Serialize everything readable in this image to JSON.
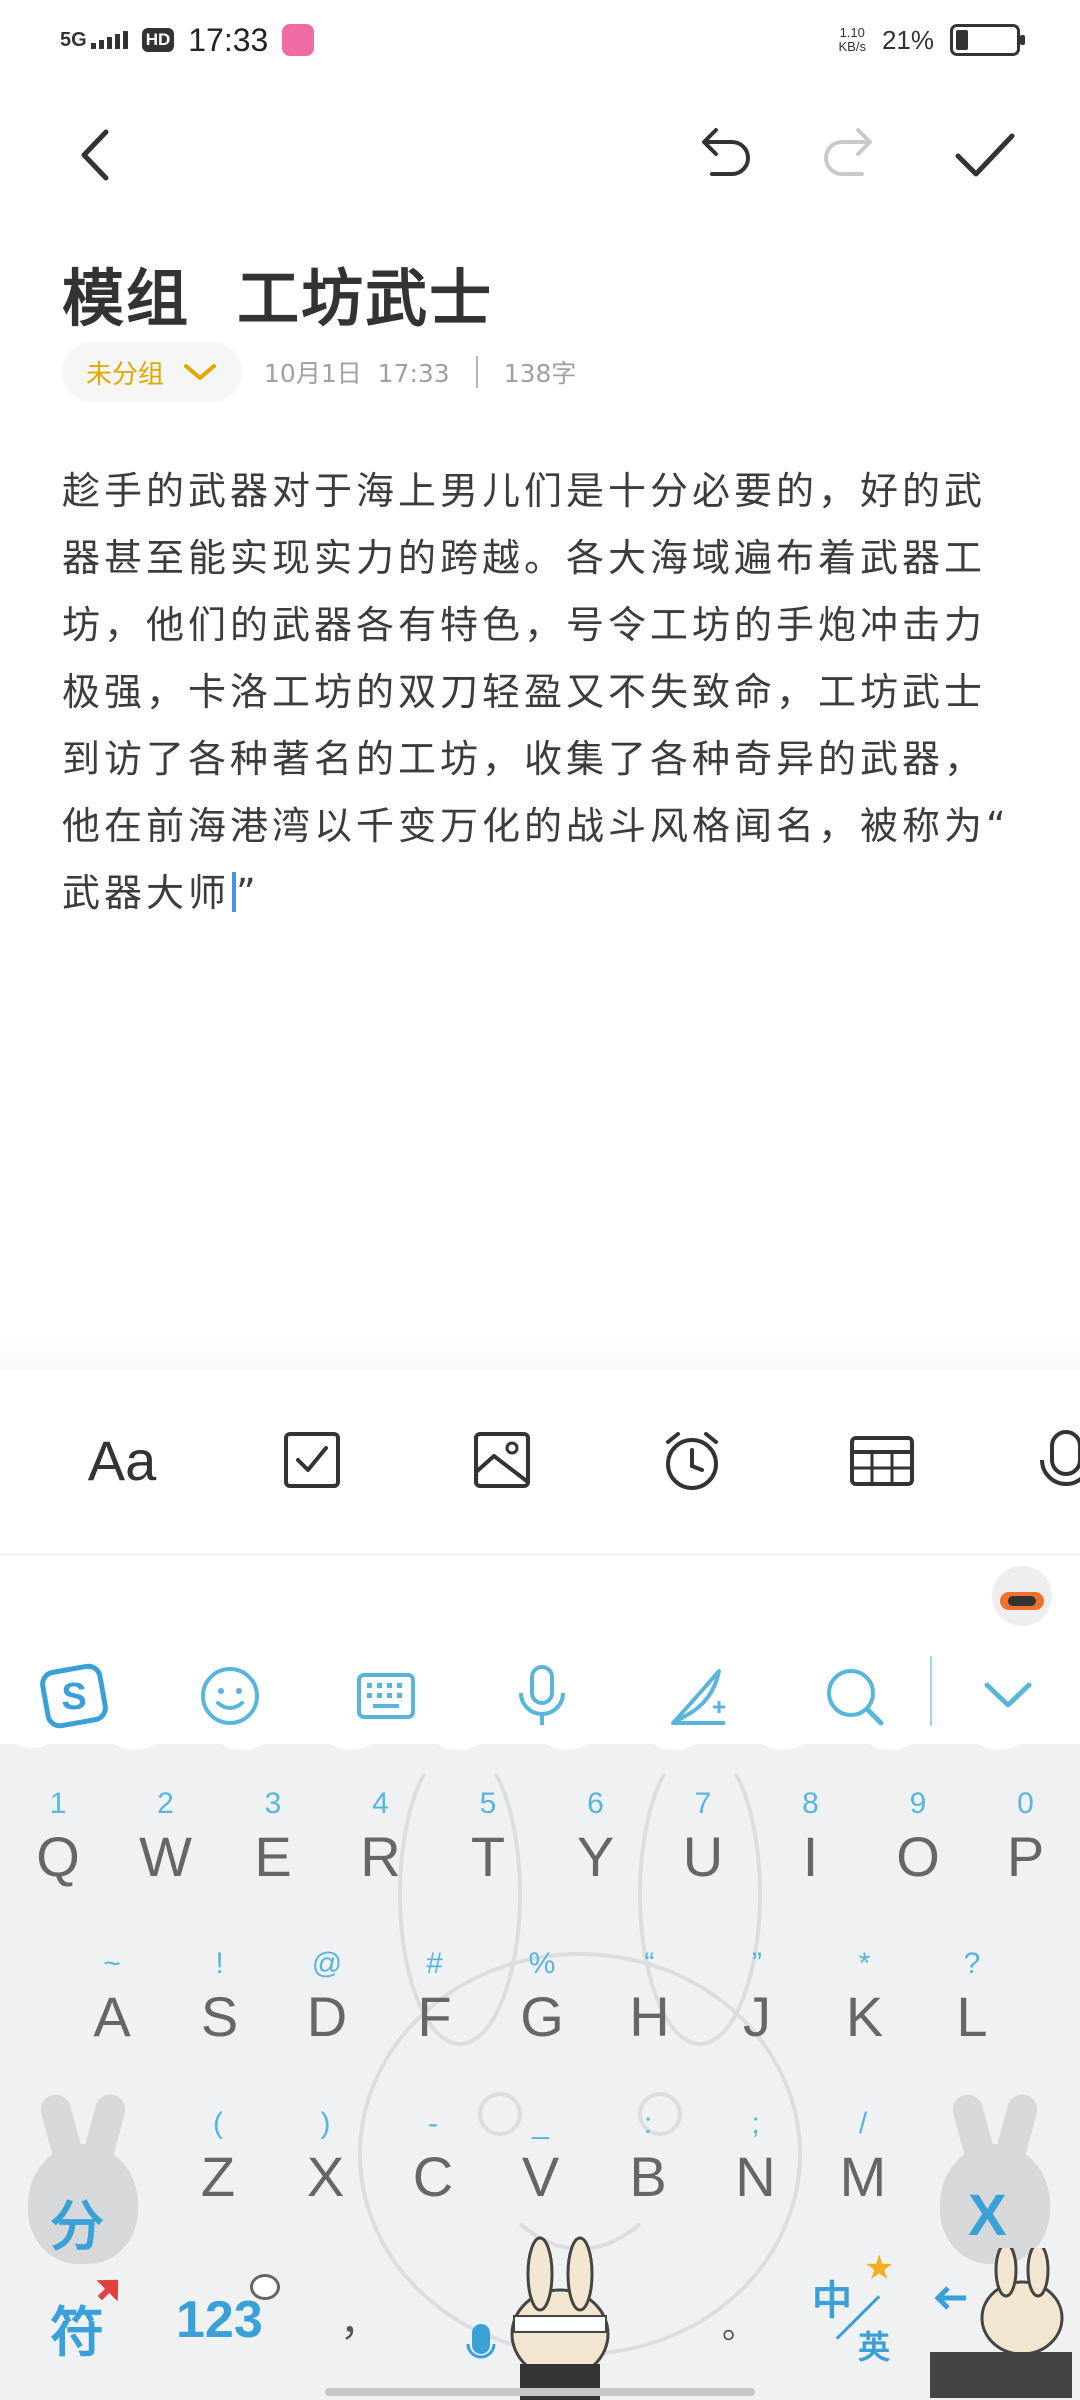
{
  "status_bar": {
    "network": "5G",
    "hd_badge": "HD",
    "time": "17:33",
    "net_speed_value": "1.10",
    "net_speed_unit": "KB/s",
    "battery_pct": "21%",
    "battery_level": 0.21
  },
  "toolbar": {
    "back_icon": "chevron-left-icon",
    "undo_icon": "undo-icon",
    "redo_icon": "redo-icon",
    "done_icon": "check-icon"
  },
  "note": {
    "title": "模组  工坊武士",
    "group": "未分组",
    "date": "10月1日  17:33",
    "word_count": "138字",
    "body": "趁手的武器对于海上男儿们是十分必要的，好的武器甚至能实现实力的跨越。各大海域遍布着武器工坊，他们的武器各有特色，号令工坊的手炮冲击力极强，卡洛工坊的双刀轻盈又不失致命，工坊武士到访了各种著名的工坊，收集了各种奇异的武器，他在前海港湾以千变万化的战斗风格闻名，被称为“ 武器大师",
    "body_tail": "”"
  },
  "format_toolbar": {
    "text_style_label": "Aa",
    "items": [
      "text-style-icon",
      "checkbox-icon",
      "image-icon",
      "alarm-icon",
      "table-icon",
      "microphone-icon"
    ]
  },
  "keyboard": {
    "toolbar_icons": [
      "sogou-logo-icon",
      "emoji-icon",
      "keyboard-icon",
      "voice-icon",
      "handwriting-icon",
      "search-icon",
      "collapse-chevron-icon"
    ],
    "row1": [
      {
        "sub": "1",
        "main": "Q"
      },
      {
        "sub": "2",
        "main": "W"
      },
      {
        "sub": "3",
        "main": "E"
      },
      {
        "sub": "4",
        "main": "R"
      },
      {
        "sub": "5",
        "main": "T"
      },
      {
        "sub": "6",
        "main": "Y"
      },
      {
        "sub": "7",
        "main": "U"
      },
      {
        "sub": "8",
        "main": "I"
      },
      {
        "sub": "9",
        "main": "O"
      },
      {
        "sub": "0",
        "main": "P"
      }
    ],
    "row2": [
      {
        "sub": "~",
        "main": "A"
      },
      {
        "sub": "!",
        "main": "S"
      },
      {
        "sub": "@",
        "main": "D"
      },
      {
        "sub": "#",
        "main": "F"
      },
      {
        "sub": "%",
        "main": "G"
      },
      {
        "sub": "“",
        "main": "H"
      },
      {
        "sub": "”",
        "main": "J"
      },
      {
        "sub": "*",
        "main": "K"
      },
      {
        "sub": "?",
        "main": "L"
      }
    ],
    "row3": [
      {
        "sub": "(",
        "main": "Z"
      },
      {
        "sub": ")",
        "main": "X"
      },
      {
        "sub": "-",
        "main": "C"
      },
      {
        "sub": "_",
        "main": "V"
      },
      {
        "sub": ":",
        "main": "B"
      },
      {
        "sub": ";",
        "main": "N"
      },
      {
        "sub": "/",
        "main": "M"
      }
    ],
    "split_key": "分",
    "delete_key": "X",
    "symbol_key": "符",
    "number_key": "123",
    "comma_key": "，",
    "period_key": "。",
    "lang_cn": "中",
    "lang_en": "英"
  },
  "colors": {
    "accent_blue": "#3aa0d8",
    "group_yellow": "#e0a800",
    "cursor_blue": "#4a90e2"
  }
}
